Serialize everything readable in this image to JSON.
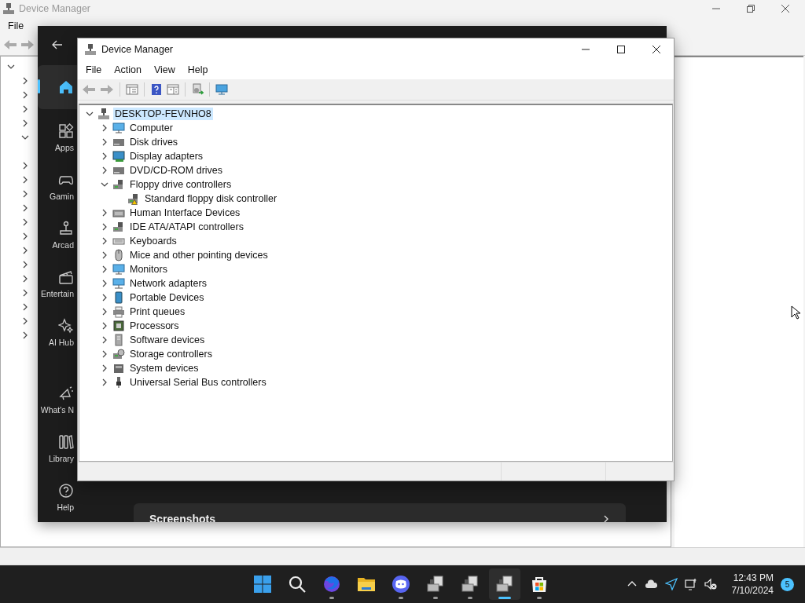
{
  "background_window": {
    "title": "Device Manager",
    "menu": [
      {
        "label": "File"
      }
    ],
    "tree": [
      {
        "kind": "branch",
        "expanded": true
      },
      {
        "kind": "branch",
        "expanded": false
      },
      {
        "kind": "branch",
        "expanded": false
      },
      {
        "kind": "branch",
        "expanded": false
      },
      {
        "kind": "branch",
        "expanded": false
      },
      {
        "kind": "branch",
        "expanded": true
      },
      {
        "kind": "leaf"
      },
      {
        "kind": "branch",
        "expanded": false
      },
      {
        "kind": "branch",
        "expanded": false
      },
      {
        "kind": "branch",
        "expanded": false
      },
      {
        "kind": "branch",
        "expanded": false
      },
      {
        "kind": "branch",
        "expanded": false
      },
      {
        "kind": "branch",
        "expanded": false
      },
      {
        "kind": "branch",
        "expanded": false
      },
      {
        "kind": "branch",
        "expanded": false
      },
      {
        "kind": "branch",
        "expanded": false
      },
      {
        "kind": "branch",
        "expanded": false
      },
      {
        "kind": "branch",
        "expanded": false
      },
      {
        "kind": "branch",
        "expanded": false
      },
      {
        "kind": "branch",
        "expanded": false
      }
    ]
  },
  "store_window": {
    "nav": [
      {
        "selected": true
      },
      {
        "label": "Apps",
        "selected": false
      },
      {
        "label": "Gamin",
        "selected": false
      },
      {
        "label": "Arcad",
        "selected": false
      },
      {
        "label": "Entertain",
        "selected": false
      },
      {
        "label": "AI Hub",
        "selected": false
      },
      {
        "label": "What's N",
        "selected": false
      },
      {
        "label": "Library",
        "selected": false
      },
      {
        "label": "Help",
        "selected": false
      }
    ],
    "card": {
      "title": "Screenshots"
    }
  },
  "device_manager": {
    "title": "Device Manager",
    "menu": [
      {
        "label": "File"
      },
      {
        "label": "Action"
      },
      {
        "label": "View"
      },
      {
        "label": "Help"
      }
    ],
    "tree": {
      "label": "DESKTOP-FEVNHO8",
      "selected": true,
      "expanded": true,
      "children": [
        {
          "label": "Computer",
          "selected": false,
          "expanded": false
        },
        {
          "label": "Disk drives",
          "selected": false,
          "expanded": false
        },
        {
          "label": "Display adapters",
          "selected": false,
          "expanded": false
        },
        {
          "label": "DVD/CD-ROM drives",
          "selected": false,
          "expanded": false
        },
        {
          "label": "Floppy drive controllers",
          "selected": false,
          "expanded": true,
          "children": [
            {
              "label": "Standard floppy disk controller",
              "selected": false,
              "warning": true
            }
          ]
        },
        {
          "label": "Human Interface Devices",
          "selected": false,
          "expanded": false
        },
        {
          "label": "IDE ATA/ATAPI controllers",
          "selected": false,
          "expanded": false
        },
        {
          "label": "Keyboards",
          "selected": false,
          "expanded": false
        },
        {
          "label": "Mice and other pointing devices",
          "selected": false,
          "expanded": false
        },
        {
          "label": "Monitors",
          "selected": false,
          "expanded": false
        },
        {
          "label": "Network adapters",
          "selected": false,
          "expanded": false
        },
        {
          "label": "Portable Devices",
          "selected": false,
          "expanded": false
        },
        {
          "label": "Print queues",
          "selected": false,
          "expanded": false
        },
        {
          "label": "Processors",
          "selected": false,
          "expanded": false
        },
        {
          "label": "Software devices",
          "selected": false,
          "expanded": false
        },
        {
          "label": "Storage controllers",
          "selected": false,
          "expanded": false
        },
        {
          "label": "System devices",
          "selected": false,
          "expanded": false
        },
        {
          "label": "Universal Serial Bus controllers",
          "selected": false,
          "expanded": false
        }
      ]
    }
  },
  "taskbar": {
    "apps": [
      {
        "running": false,
        "selected": false
      },
      {
        "running": false,
        "selected": false
      },
      {
        "running": true,
        "selected": false
      },
      {
        "running": false,
        "selected": false
      },
      {
        "running": true,
        "selected": false
      },
      {
        "running": true,
        "selected": false
      },
      {
        "running": true,
        "selected": false
      },
      {
        "running": true,
        "selected": true
      },
      {
        "running": true,
        "selected": false
      }
    ],
    "clock": {
      "time": "12:43 PM",
      "date": "7/10/2024"
    },
    "notifications": "5"
  }
}
